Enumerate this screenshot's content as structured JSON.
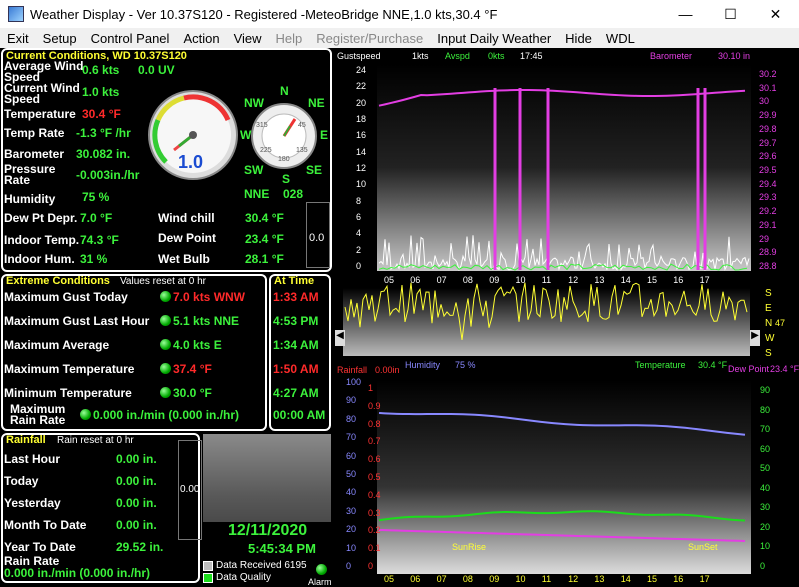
{
  "window": {
    "title": "Weather Display - Ver 10.37S120 - Registered  -MeteoBridge NNE,1.0 kts,30.4 °F",
    "minimize": "—",
    "maximize": "☐",
    "close": "✕"
  },
  "menu": [
    {
      "label": "Exit",
      "disabled": false
    },
    {
      "label": "Setup",
      "disabled": false
    },
    {
      "label": "Control Panel",
      "disabled": false
    },
    {
      "label": "Action",
      "disabled": false
    },
    {
      "label": "View",
      "disabled": false
    },
    {
      "label": "Help",
      "disabled": false
    },
    {
      "label": "Register/Purchase",
      "disabled": true
    },
    {
      "label": "Input Daily Weather",
      "disabled": false
    },
    {
      "label": "Hide",
      "disabled": false
    },
    {
      "label": "WDL",
      "disabled": false
    }
  ],
  "current": {
    "header": "Current Conditions, WD 10.37S120",
    "avg_wind_label": "Average Wind Speed",
    "avg_wind_value": "0.6 kts",
    "uv_value": "0.0 UV",
    "cur_wind_label": "Current Wind Speed",
    "cur_wind_value": "1.0 kts",
    "temp_label": "Temperature",
    "temp_value": "30.4 °F",
    "temp_rate_label": "Temp Rate",
    "temp_rate_value": "-1.3 °F /hr",
    "baro_label": "Barometer",
    "baro_value": "30.082 in.",
    "press_rate_label": "Pressure Rate",
    "press_rate_value": "-0.003in./hr",
    "humidity_label": "Humidity",
    "humidity_value": "75 %",
    "dewdepr_label": "Dew Pt Depr.",
    "dewdepr_value": "7.0 °F",
    "windchill_label": "Wind chill",
    "windchill_value": "30.4 °F",
    "indoor_temp_label": "Indoor Temp.",
    "indoor_temp_value": "74.3 °F",
    "dewpoint_label": "Dew Point",
    "dewpoint_value": "23.4 °F",
    "indoor_hum_label": "Indoor Hum.",
    "indoor_hum_value": "31 %",
    "wetbulb_label": "Wet Bulb",
    "wetbulb_value": "28.1 °F",
    "side_box_value": "0.0",
    "gauge_value": "1.0",
    "compass_dir": "NNE",
    "compass_deg": "028",
    "compass_labels": {
      "n": "N",
      "ne": "NE",
      "e": "E",
      "se": "SE",
      "s": "S",
      "sw": "SW",
      "w": "W",
      "nw": "NW"
    },
    "compass_ticks": {
      "t315": "315",
      "t45": "45",
      "t225": "225",
      "t135": "135",
      "t180": "180"
    }
  },
  "extreme": {
    "header": "Extreme Conditions",
    "subheader": "Values reset at 0 hr",
    "at_time_header": "At Time",
    "rows": [
      {
        "label": "Maximum Gust Today",
        "value": "7.0 kts WNW",
        "time": "1:33 AM",
        "red": true
      },
      {
        "label": "Maximum Gust Last Hour",
        "value": "5.1 kts NNE",
        "time": "4:53 PM",
        "red": false
      },
      {
        "label": "Maximum Average",
        "value": "4.0 kts E",
        "time": "1:34 AM",
        "red": false
      },
      {
        "label": "Maximum Temperature",
        "value": "37.4 °F",
        "time": "1:50 AM",
        "red": true
      },
      {
        "label": "Minimum Temperature",
        "value": "30.0 °F",
        "time": "4:27 AM",
        "red": false
      },
      {
        "label": "Maximum Rain Rate",
        "value": "0.000 in./min (0.000 in./hr)",
        "time": "00:00 AM",
        "red": false
      }
    ]
  },
  "rainfall": {
    "header": "Rainfall",
    "subheader": "Rain reset at 0 hr",
    "rows": [
      {
        "label": "Last Hour",
        "value": "0.00 in."
      },
      {
        "label": "Today",
        "value": "0.00 in."
      },
      {
        "label": "Yesterday",
        "value": "0.00 in."
      },
      {
        "label": "Month To Date",
        "value": "0.00 in."
      },
      {
        "label": "Year To Date",
        "value": "29.52 in."
      }
    ],
    "rate_label": "Rain Rate",
    "rate_value": "0.000 in./min (0.000 in./hr)",
    "gauge_value": "0.00"
  },
  "datetime": {
    "date": "12/11/2020",
    "time": "5:45:34 PM"
  },
  "status": {
    "data_received": "Data Received 6195",
    "data_quality": "Data Quality",
    "alarm": "Alarm"
  },
  "charts": {
    "top": {
      "gust_label": "Gustspeed",
      "gust_val": "1kts",
      "avg_label": "Avspd",
      "avg_val": "0kts",
      "time_label": "17:45",
      "baro_label": "Barometer",
      "baro_val": "30.10 in",
      "left_ticks": [
        "24",
        "22",
        "20",
        "18",
        "16",
        "14",
        "12",
        "10",
        "8",
        "6",
        "4",
        "2",
        "0"
      ],
      "right_ticks": [
        "30.2",
        "30.1",
        "30",
        "29.9",
        "29.8",
        "29.7",
        "29.6",
        "29.5",
        "29.4",
        "29.3",
        "29.2",
        "29.1",
        "29",
        "28.9",
        "28.8"
      ],
      "x_ticks": [
        "05",
        "06",
        "07",
        "08",
        "09",
        "10",
        "11",
        "12",
        "13",
        "14",
        "15",
        "16",
        "17"
      ]
    },
    "wind_dir": {
      "compass_letters": [
        "S",
        "E",
        "N",
        "W",
        "S"
      ],
      "value": "47",
      "humidity_label": "Humidity",
      "humidity_val": "75 %",
      "temp_label": "Temperature",
      "temp_val": "30.4 °F",
      "dew_label": "Dew Point",
      "dew_val": "23.4 °F"
    },
    "bottom": {
      "rain_label": "Rainfall",
      "rain_val": "0.00in",
      "left_ticks": [
        "100",
        "90",
        "80",
        "70",
        "60",
        "50",
        "40",
        "30",
        "20",
        "10",
        "0"
      ],
      "rain_ticks": [
        "1",
        "0.9",
        "0.8",
        "0.7",
        "0.6",
        "0.5",
        "0.4",
        "0.3",
        "0.2",
        "0.1",
        "0"
      ],
      "right_ticks": [
        "90",
        "80",
        "70",
        "60",
        "50",
        "40",
        "30",
        "20",
        "10",
        "0"
      ],
      "sunrise": "SunRise",
      "sunset": "SunSet",
      "x_ticks": [
        "05",
        "06",
        "07",
        "08",
        "09",
        "10",
        "11",
        "12",
        "13",
        "14",
        "15",
        "16",
        "17"
      ]
    }
  }
}
